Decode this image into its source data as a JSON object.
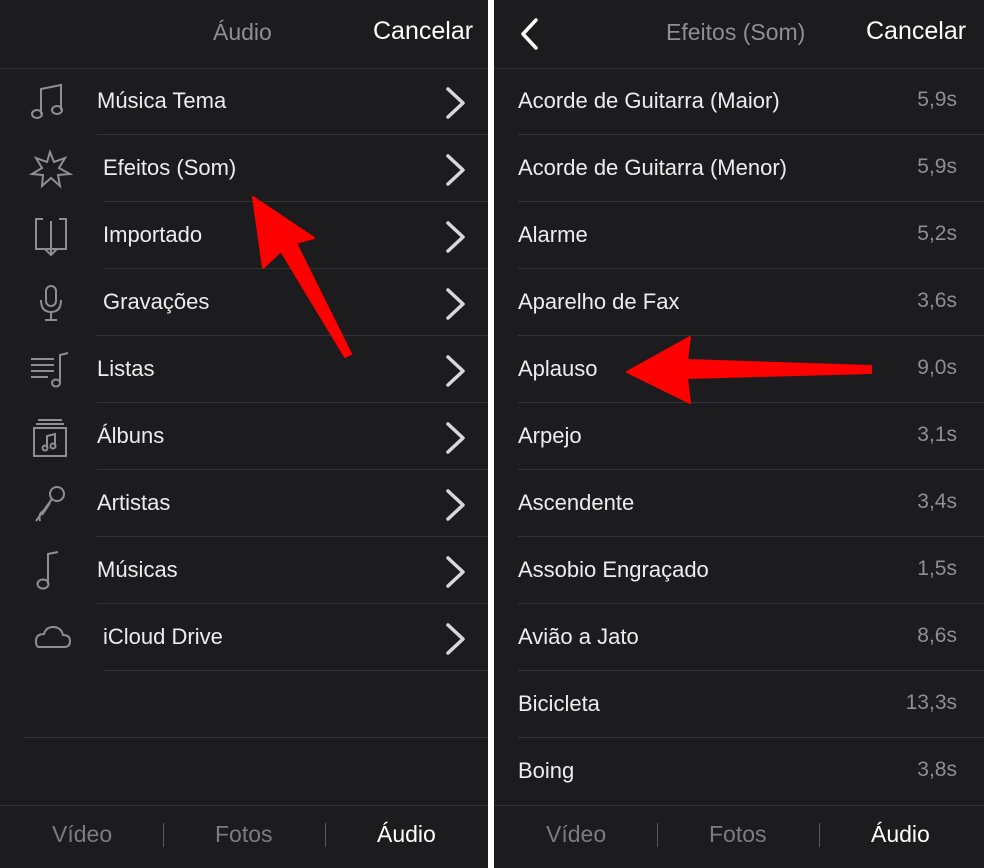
{
  "left": {
    "header": {
      "title": "Áudio",
      "cancel_label": "Cancelar"
    },
    "items": [
      {
        "label": "Música Tema",
        "icon": "music-note-icon"
      },
      {
        "label": "Efeitos (Som)",
        "icon": "starburst-icon"
      },
      {
        "label": "Importado",
        "icon": "import-icon"
      },
      {
        "label": "Gravações",
        "icon": "microphone-icon"
      },
      {
        "label": "Listas",
        "icon": "playlist-icon"
      },
      {
        "label": "Álbuns",
        "icon": "album-icon"
      },
      {
        "label": "Artistas",
        "icon": "artist-microphone-icon"
      },
      {
        "label": "Músicas",
        "icon": "song-note-icon"
      },
      {
        "label": "iCloud Drive",
        "icon": "cloud-icon"
      }
    ],
    "tabs": [
      {
        "label": "Vídeo",
        "active": false
      },
      {
        "label": "Fotos",
        "active": false
      },
      {
        "label": "Áudio",
        "active": true
      }
    ]
  },
  "right": {
    "header": {
      "title": "Efeitos (Som)",
      "cancel_label": "Cancelar"
    },
    "items": [
      {
        "label": "Acorde de Guitarra (Maior)",
        "duration": "5,9s"
      },
      {
        "label": "Acorde de Guitarra (Menor)",
        "duration": "5,9s"
      },
      {
        "label": "Alarme",
        "duration": "5,2s"
      },
      {
        "label": "Aparelho de Fax",
        "duration": "3,6s"
      },
      {
        "label": "Aplauso",
        "duration": "9,0s"
      },
      {
        "label": "Arpejo",
        "duration": "3,1s"
      },
      {
        "label": "Ascendente",
        "duration": "3,4s"
      },
      {
        "label": "Assobio Engraçado",
        "duration": "1,5s"
      },
      {
        "label": "Avião a Jato",
        "duration": "8,6s"
      },
      {
        "label": "Bicicleta",
        "duration": "13,3s"
      },
      {
        "label": "Boing",
        "duration": "3,8s"
      }
    ],
    "tabs": [
      {
        "label": "Vídeo",
        "active": false
      },
      {
        "label": "Fotos",
        "active": false
      },
      {
        "label": "Áudio",
        "active": true
      }
    ]
  },
  "colors": {
    "background": "#1c1c1e",
    "separator": "#333335",
    "annotation_arrow": "#ff0000",
    "muted_text": "#8e8e93"
  }
}
